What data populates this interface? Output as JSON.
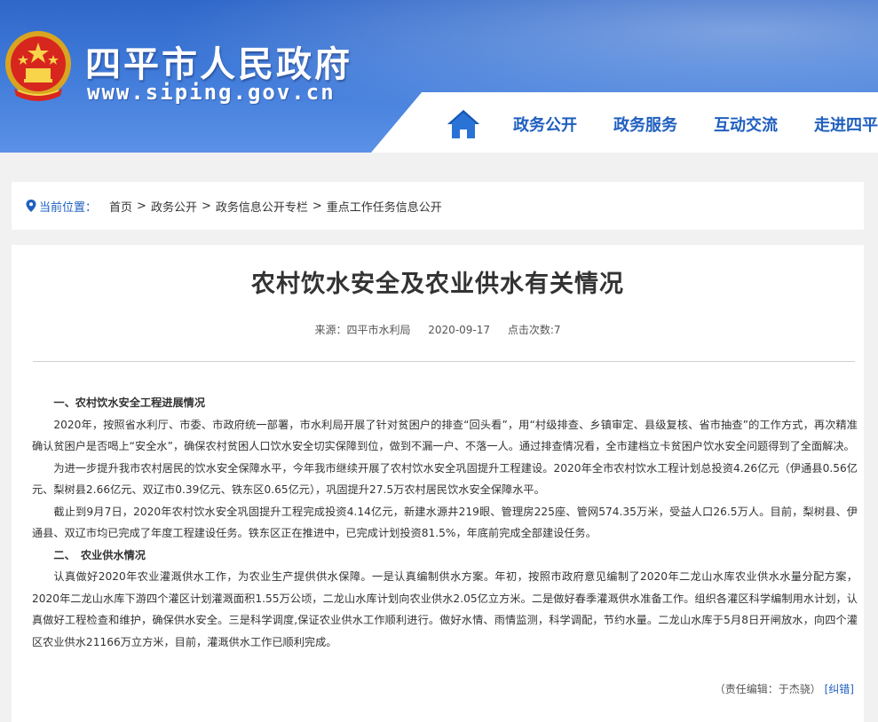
{
  "header": {
    "site_name": "四平市人民政府",
    "site_url": "www.siping.gov.cn",
    "nav": [
      {
        "label": "政务公开"
      },
      {
        "label": "政务服务"
      },
      {
        "label": "互动交流"
      },
      {
        "label": "走进四平"
      }
    ],
    "home_icon": "home-icon",
    "colors": {
      "brand_blue": "#3f7ad9",
      "nav_text": "#1f5fbf"
    }
  },
  "breadcrumb": {
    "label": "当前位置：",
    "items": [
      "首页",
      "政务公开",
      "政务信息公开专栏",
      "重点工作任务信息公开"
    ],
    "separator": ">"
  },
  "article": {
    "title": "农村饮水安全及农业供水有关情况",
    "source": "来源：四平市水利局",
    "date": "2020-09-17",
    "clicks": "点击次数:7",
    "paragraphs": [
      {
        "text": "一、农村饮水安全工程进展情况",
        "heading": true
      },
      {
        "text": "2020年，按照省水利厅、市委、市政府统一部署，市水利局开展了针对贫困户的排查“回头看”，用“村级排查、乡镇审定、县级复核、省市抽查”的工作方式，再次精准确认贫困户是否喝上“安全水”，确保农村贫困人口饮水安全切实保障到位，做到不漏一户、不落一人。通过排查情况看，全市建档立卡贫困户饮水安全问题得到了全面解决。",
        "heading": false
      },
      {
        "text": "为进一步提升我市农村居民的饮水安全保障水平，今年我市继续开展了农村饮水安全巩固提升工程建设。2020年全市农村饮水工程计划总投资4.26亿元（伊通县0.56亿元、梨树县2.66亿元、双辽市0.39亿元、铁东区0.65亿元），巩固提升27.5万农村居民饮水安全保障水平。",
        "heading": false
      },
      {
        "text": "截止到9月7日，2020年农村饮水安全巩固提升工程完成投资4.14亿元，新建水源井219眼、管理房225座、管网574.35万米，受益人口26.5万人。目前，梨树县、伊通县、双辽市均已完成了年度工程建设任务。铁东区正在推进中，已完成计划投资81.5%，年底前完成全部建设任务。",
        "heading": false
      },
      {
        "text": "二、　农业供水情况",
        "heading": true
      },
      {
        "text": "认真做好2020年农业灌溉供水工作，为农业生产提供供水保障。一是认真编制供水方案。年初，按照市政府意见编制了2020年二龙山水库农业供水水量分配方案，2020年二龙山水库下游四个灌区计划灌溉面积1.55万公顷，二龙山水库计划向农业供水2.05亿立方米。二是做好春季灌溉供水准备工作。组织各灌区科学编制用水计划，认真做好工程检查和维护，确保供水安全。三是科学调度,保证农业供水工作顺利进行。做好水情、雨情监测，科学调配，节约水量。二龙山水库于5月8日开闸放水，向四个灌区农业供水21166万立方米，目前，灌溉供水工作已顺利完成。",
        "heading": false
      }
    ],
    "editor": "（责任编辑：于杰骁）",
    "correction": "[纠错]"
  }
}
